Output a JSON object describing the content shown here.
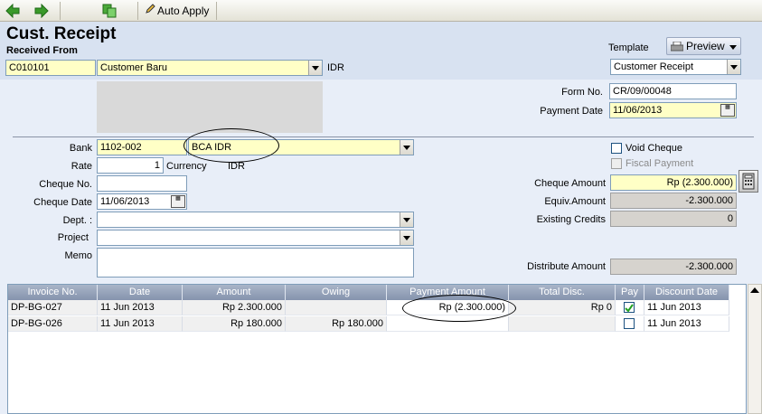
{
  "toolbar": {
    "auto_apply_label": "Auto Apply"
  },
  "header": {
    "title": "Cust. Receipt",
    "received_from_label": "Received From",
    "template_label": "Template",
    "preview_label": "Preview",
    "customer_code": "C010101",
    "customer_name": "Customer Baru",
    "currency": "IDR",
    "template_value": "Customer Receipt"
  },
  "form": {
    "form_no_label": "Form No.",
    "form_no": "CR/09/00048",
    "payment_date_label": "Payment Date",
    "payment_date": "11/06/2013",
    "bank_label": "Bank",
    "bank_code": "1102-002",
    "bank_name": "BCA IDR",
    "rate_label": "Rate",
    "rate_value": "1",
    "currency_label": "Currency",
    "currency_value": "IDR",
    "cheque_no_label": "Cheque No.",
    "cheque_no": "",
    "cheque_date_label": "Cheque Date",
    "cheque_date": "11/06/2013",
    "dept_label": "Dept. :",
    "dept_value": "",
    "project_label": "Project",
    "project_value": "",
    "memo_label": "Memo",
    "memo_value": "",
    "void_cheque_label": "Void Cheque",
    "fiscal_payment_label": "Fiscal Payment",
    "cheque_amount_label": "Cheque Amount",
    "cheque_amount": "Rp (2.300.000)",
    "equiv_amount_label": "Equiv.Amount",
    "equiv_amount": "-2.300.000",
    "existing_credits_label": "Existing Credits",
    "existing_credits": "0",
    "distribute_amount_label": "Distribute Amount",
    "distribute_amount": "-2.300.000"
  },
  "grid": {
    "columns": [
      "Invoice No.",
      "Date",
      "Amount",
      "Owing",
      "Payment Amount",
      "Total Disc.",
      "Pay",
      "Discount Date"
    ],
    "rows": [
      {
        "invoice": "DP-BG-027",
        "date": "11 Jun 2013",
        "amount": "Rp 2.300.000",
        "owing": "",
        "payment": "Rp (2.300.000)",
        "disc": "Rp 0",
        "pay": true,
        "disc_date": "11 Jun 2013"
      },
      {
        "invoice": "DP-BG-026",
        "date": "11 Jun 2013",
        "amount": "Rp 180.000",
        "owing": "Rp 180.000",
        "payment": "",
        "disc": "",
        "pay": false,
        "disc_date": "11 Jun 2013"
      }
    ]
  },
  "colors": {
    "accent_yellow": "#ffffc6",
    "grid_header": "#8d9bb4",
    "header_bg": "#d8e2f1"
  }
}
